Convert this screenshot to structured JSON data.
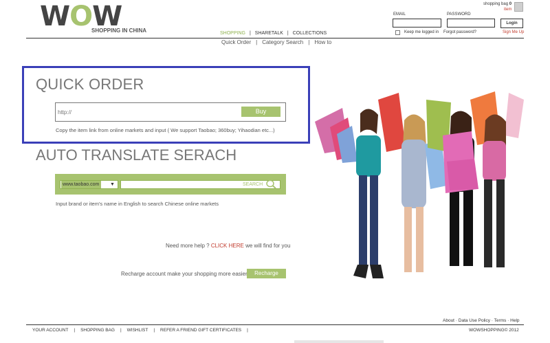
{
  "logo": {
    "wordmark_left": "W",
    "wordmark_mid": "O",
    "wordmark_right": "W",
    "tagline": "SHOPPING IN CHINA"
  },
  "nav": {
    "items": [
      "SHOPPING",
      "SHARETALK",
      "COLLECTIONS"
    ],
    "sep": "|"
  },
  "subnav": {
    "items": [
      "Quick Order",
      "Category Search",
      "How to"
    ],
    "sep": "|"
  },
  "login": {
    "email_label": "EMAIL",
    "password_label": "PASSWORD",
    "login_button": "Login",
    "keep_logged_in": "Keep me logged in",
    "forgot": "Forgot password?",
    "signup": "Sign Me Up"
  },
  "bag": {
    "label": "shopping bag",
    "count": "0",
    "unit": "item"
  },
  "quick_order": {
    "title": "QUICK ORDER",
    "placeholder": "http://",
    "buy_button": "Buy",
    "hint": "Copy the item link from online markets and input ( We support Taobao; 360buy; Yihaodian etc...)"
  },
  "auto_translate": {
    "title": "AUTO TRANSLATE SERACH",
    "site_selected": "www.taobao.com",
    "search_label": "SEARCH",
    "hint": "Input brand or item's name in English to search Chinese online markets"
  },
  "help": {
    "before": "Need more help ? ",
    "link": "CLICK HERE",
    "after": " we will find for you"
  },
  "recharge": {
    "text": "Recharge account make your shopping more easier",
    "button": "Recharge"
  },
  "footer": {
    "right_links": "About · Data Use Policy · Terms · Help",
    "nav": [
      "YOUR ACCOUNT",
      "SHOPPING BAG",
      "WISHLIST",
      "REFER A FRIEND GIFT CERTIFICATES"
    ],
    "sep": "|",
    "copyright": "WOWSHOPPING© 2012"
  },
  "colors": {
    "accent": "#a7c36f",
    "highlight": "#3a3fb8",
    "link_red": "#c0392b"
  }
}
